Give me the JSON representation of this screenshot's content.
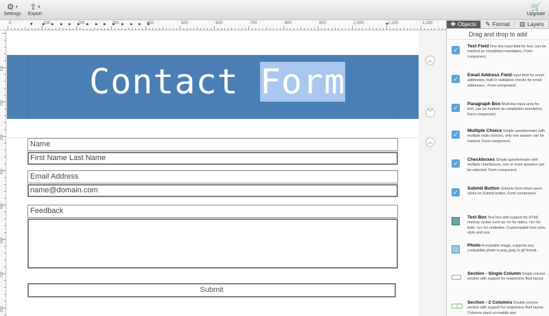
{
  "toolbar": {
    "settings_label": "Settings",
    "export_label": "Export",
    "upgrade_label": "Upgrade"
  },
  "ruler": {
    "top_labels": [
      "0",
      "100",
      "200",
      "300",
      "400",
      "500",
      "600",
      "700",
      "800",
      "900",
      "1,000",
      "1,100",
      "1,200"
    ],
    "left_labels": [
      "100",
      "200",
      "300",
      "400",
      "500",
      "600",
      "700",
      "800"
    ]
  },
  "header": {
    "title_plain": "Contact ",
    "title_selected": "Form",
    "bg_color": "#4a7fb5"
  },
  "form": {
    "name_label": "Name",
    "name_placeholder": "First Name Last Name",
    "email_label": "Email Address",
    "email_placeholder": "name@domain.com",
    "feedback_label": "Feedback",
    "submit_label": "Submit"
  },
  "panel": {
    "tabs": [
      {
        "label": "Objects",
        "active": true
      },
      {
        "label": "Format",
        "active": false
      },
      {
        "label": "Layers",
        "active": false
      }
    ],
    "drag_hint": "Drag and drop to add",
    "objects": [
      {
        "name": "Text Field",
        "desc": "One line input field for text, can be marked as completion mandatory.  Form component.",
        "icon": "checkbox-icon"
      },
      {
        "name": "Email Address Field",
        "desc": "Input field for email addresses, built in validation checks for email addresses..  Form component.",
        "icon": "checkbox-icon"
      },
      {
        "name": "Paragraph Box",
        "desc": "Multi-line input area for text, can be marked as completion mandatory.  Form component.",
        "icon": "checkbox-icon"
      },
      {
        "name": "Multiple Choice",
        "desc": "Simple questionnaire with multiple radio choices, only one answer can be marked.  Form component.",
        "icon": "checkbox-icon"
      },
      {
        "name": "Checkboxes",
        "desc": "Simple questionnaire with multiple checkboxes, one or more answers can be selected.  Form component.",
        "icon": "checkbox-icon"
      },
      {
        "name": "Submit Button",
        "desc": "Submits form when users clicks on Submit button.  Form component.",
        "icon": "checkbox-icon"
      },
      {
        "name": "Text Box",
        "desc": "Text box with support for HTML markup syntax such as <i> for italics, <b> for bold, <u> for underline. Customizable font color, style and size.",
        "icon": "textbox-icon"
      },
      {
        "name": "Photo",
        "desc": "A resizable image, supports any compatible photo in png, jpeg or gif format.",
        "icon": "photo-icon"
      },
      {
        "name": "Section - Single Column",
        "desc": "Single column section with support for responsive fluid layout.",
        "icon": "single-column-icon"
      },
      {
        "name": "Section - 2 Columns",
        "desc": "Double column section with support for responsive fluid layout.  Columns stack on mobile size",
        "icon": "two-column-icon"
      }
    ]
  }
}
